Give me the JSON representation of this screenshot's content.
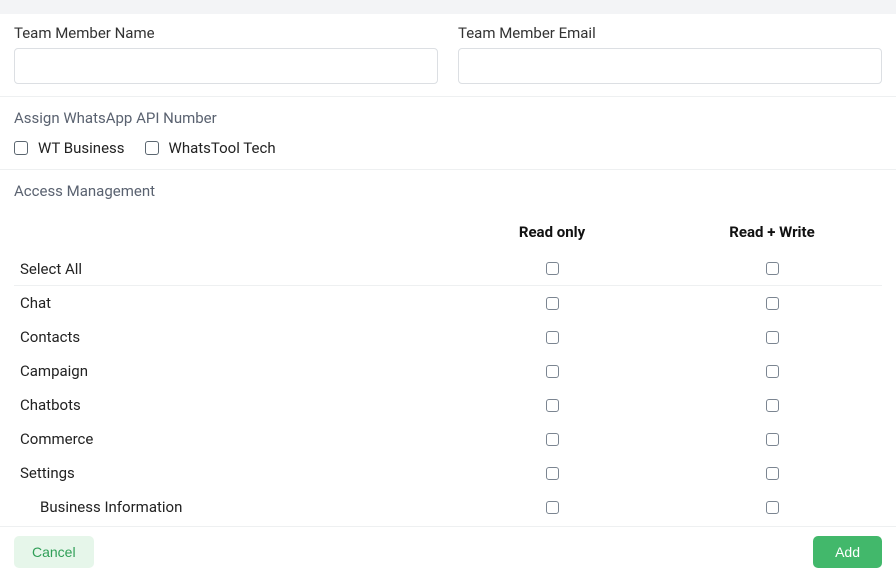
{
  "fields": {
    "name_label": "Team Member Name",
    "name_value": "",
    "email_label": "Team Member Email",
    "email_value": ""
  },
  "assign": {
    "title": "Assign WhatsApp API Number",
    "options": [
      "WT Business",
      "WhatsTool Tech"
    ]
  },
  "access": {
    "title": "Access Management",
    "columns": {
      "read": "Read only",
      "read_write": "Read + Write"
    },
    "rows": [
      {
        "label": "Select All",
        "indent": false,
        "divider": true,
        "read": false,
        "rw": false
      },
      {
        "label": "Chat",
        "indent": false,
        "divider": false,
        "read": false,
        "rw": false
      },
      {
        "label": "Contacts",
        "indent": false,
        "divider": false,
        "read": false,
        "rw": false
      },
      {
        "label": "Campaign",
        "indent": false,
        "divider": false,
        "read": false,
        "rw": false
      },
      {
        "label": "Chatbots",
        "indent": false,
        "divider": false,
        "read": false,
        "rw": false
      },
      {
        "label": "Commerce",
        "indent": false,
        "divider": false,
        "read": false,
        "rw": false
      },
      {
        "label": "Settings",
        "indent": false,
        "divider": false,
        "read": false,
        "rw": false
      },
      {
        "label": "Business Information",
        "indent": true,
        "divider": false,
        "read": false,
        "rw": false
      }
    ]
  },
  "footer": {
    "cancel": "Cancel",
    "add": "Add"
  }
}
